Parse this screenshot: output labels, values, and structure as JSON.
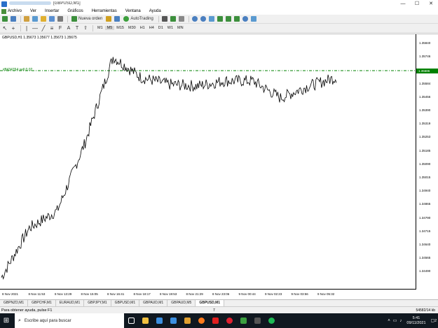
{
  "window": {
    "title": "[GBPUSD,M1]",
    "minimize": "—",
    "maximize": "☐",
    "close": "✕"
  },
  "menu": [
    "Archivo",
    "Ver",
    "Insertar",
    "Gráficos",
    "Herramientas",
    "Ventana",
    "Ayuda"
  ],
  "toolbar1": {
    "new_order": "Nueva orden",
    "autotrading": "AutoTrading"
  },
  "timeframes": [
    "M1",
    "M5",
    "M15",
    "M30",
    "H1",
    "H4",
    "D1",
    "W1",
    "MN"
  ],
  "active_timeframe": "M5",
  "chart": {
    "header": "GBPUSD,H1  1.35673 1.35677 1.35673 1.35675",
    "order_label": "#8434764 sell 0.02",
    "current_price": "1.35686",
    "y_ticks": [
      "1.35840",
      "1.35746",
      "1.35613",
      "1.35584",
      "1.35456",
      "1.35390",
      "1.35319",
      "1.35253",
      "1.35185",
      "1.35090",
      "1.35015",
      "1.34940",
      "1.34865",
      "1.34790",
      "1.34715",
      "1.34640",
      "1.34565",
      "1.34490"
    ],
    "x_ticks": [
      "8 Nov 2021",
      "8 Nov 11:53",
      "8 Nov 13:29",
      "8 Nov 15:05",
      "8 Nov 16:41",
      "8 Nov 18:17",
      "8 Nov 19:53",
      "8 Nov 21:29",
      "8 Nov 23:06",
      "9 Nov 00:44",
      "9 Nov 02:23",
      "9 Nov 03:56",
      "9 Nov 05:32"
    ],
    "line_color": "#000000",
    "order_line_color": "#008000"
  },
  "chart_data": {
    "type": "line",
    "title": "GBPUSD,H1",
    "x": [
      "8 Nov 2021",
      "8 Nov 11:53",
      "8 Nov 13:29",
      "8 Nov 15:05",
      "8 Nov 16:41",
      "8 Nov 18:17",
      "8 Nov 19:53",
      "8 Nov 21:29",
      "8 Nov 23:06",
      "9 Nov 00:44",
      "9 Nov 02:23",
      "9 Nov 03:56",
      "9 Nov 05:32"
    ],
    "series": [
      {
        "name": "",
        "values": [
          1.3451,
          1.348,
          1.349,
          1.353,
          1.358,
          1.3568,
          1.3564,
          1.3563,
          1.3566,
          1.3566,
          1.3556,
          1.3563,
          1.3568
        ]
      }
    ],
    "ylim": [
      1.3446,
      1.359
    ],
    "xlabel": "",
    "ylabel": "",
    "grid": false
  },
  "tabs": [
    "GBPNZD,M1",
    "GBPCHF,M1",
    "EURAUD,M1",
    "GBPJPY,M1",
    "GBPUSD,M1",
    "GBPAUD,M1",
    "GBPAUD,M5",
    "GBPUSD,M1"
  ],
  "active_tab_index": 7,
  "status": {
    "help": "Para obtener ayuda, pulse F1",
    "code": "7",
    "kb": "54582/14 kb"
  },
  "taskbar": {
    "search_placeholder": "Escribe aquí para buscar",
    "time": "5:41",
    "date": "09/11/2021",
    "notifications": "2"
  }
}
